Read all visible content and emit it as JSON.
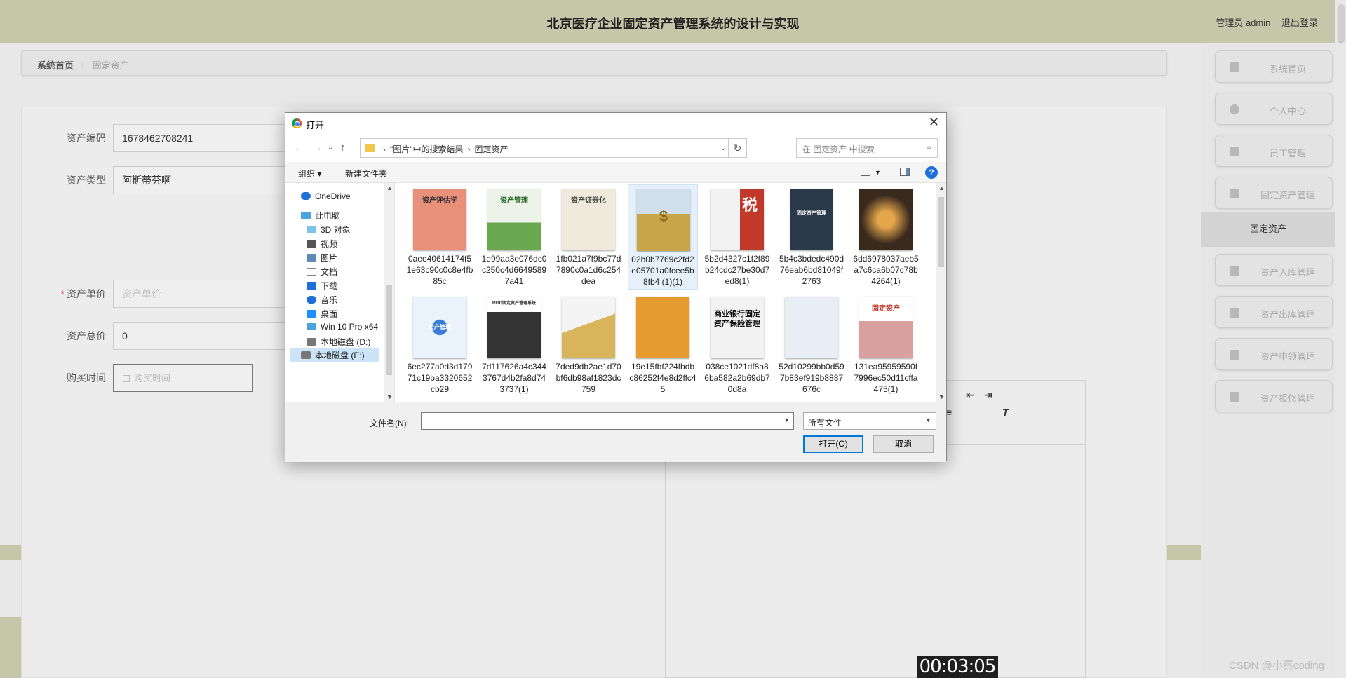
{
  "header": {
    "title": "北京医疗企业固定资产管理系统的设计与实现",
    "user_label": "管理员 admin",
    "logout_label": "退出登录"
  },
  "breadcrumb": {
    "home": "系统首页",
    "current": "固定资产"
  },
  "form": {
    "asset_code_label": "资产编码",
    "asset_code_value": "1678462708241",
    "asset_type_label": "资产类型",
    "asset_type_value": "阿斯蒂芬啊",
    "unit_price_label": "资产单价",
    "unit_price_required": "*",
    "unit_price_placeholder": "资产单价",
    "total_price_label": "资产总价",
    "total_price_value": "0",
    "purchase_time_label": "购买时间",
    "purchase_time_placeholder": "购买时间"
  },
  "sidebar": {
    "items": [
      {
        "label": "系统首页",
        "icon": "home-icon"
      },
      {
        "label": "个人中心",
        "icon": "user-icon"
      },
      {
        "label": "员工管理",
        "icon": "grid-icon"
      },
      {
        "label": "固定资产管理",
        "icon": "clipboard-icon"
      },
      {
        "label": "资产入库管理",
        "icon": "grid-icon"
      },
      {
        "label": "资产出库管理",
        "icon": "briefcase-icon"
      },
      {
        "label": "资产申领管理",
        "icon": "chart-icon"
      },
      {
        "label": "资产报修管理",
        "icon": "chart-icon"
      }
    ],
    "active_sub": "固定资产"
  },
  "dialog": {
    "title": "打开",
    "path": [
      "\"图片\"中的搜索结果",
      "固定资产"
    ],
    "search_placeholder": "在 固定资产 中搜索",
    "organize_label": "组织 ▾",
    "new_folder_label": "新建文件夹",
    "nav_items": [
      {
        "label": "OneDrive",
        "icon": "cloud-icon",
        "color": "#1e6fd9"
      },
      {
        "label": "此电脑",
        "icon": "computer-icon",
        "color": "#4aa3df"
      },
      {
        "label": "3D 对象",
        "icon": "cube-icon",
        "color": "#7cc4ea"
      },
      {
        "label": "视频",
        "icon": "video-icon",
        "color": "#555555"
      },
      {
        "label": "图片",
        "icon": "picture-icon",
        "color": "#5b8cb8"
      },
      {
        "label": "文档",
        "icon": "document-icon",
        "color": "#888888"
      },
      {
        "label": "下载",
        "icon": "download-icon",
        "color": "#1e6fd9"
      },
      {
        "label": "音乐",
        "icon": "music-icon",
        "color": "#1e6fd9"
      },
      {
        "label": "桌面",
        "icon": "desktop-icon",
        "color": "#1e90ff"
      },
      {
        "label": "Win 10 Pro x64",
        "icon": "drive-icon",
        "color": "#4aa3df"
      },
      {
        "label": "本地磁盘 (D:)",
        "icon": "drive-icon",
        "color": "#777777"
      },
      {
        "label": "本地磁盘 (E:)",
        "icon": "drive-icon",
        "color": "#777777"
      }
    ],
    "files": [
      {
        "name": "0aee40614174f51e63c90c0c8e4fb85c",
        "thumb_text": "资产评估学",
        "color": "#e8907a"
      },
      {
        "name": "1e99aa3e076dc0c250c4d66495897a41",
        "thumb_text": "资产管理",
        "color": "#6aa84f"
      },
      {
        "name": "1fb021a7f9bc77d7890c0a1d6c254dea",
        "thumb_text": "资产证券化",
        "color": "#d9d2c0"
      },
      {
        "name": "02b0b7769c2fd2e05701a0fcee5b8fb4 (1)(1)",
        "thumb_text": "$",
        "color": "#c9a54a"
      },
      {
        "name": "5b2d4327c1f2f89b24cdc27be30d7ed8(1)",
        "thumb_text": "税",
        "color": "#c0392b"
      },
      {
        "name": "5b4c3bdedc490d76eab6bd81049f2763",
        "thumb_text": "固定资产管理",
        "color": "#2b3a4a"
      },
      {
        "name": "6dd6978037aeb5a7c6ca6b07c78b4264(1)",
        "thumb_text": "",
        "color": "#5a3d2b"
      },
      {
        "name": "6ec277a0d3d17971c19ba3320652cb29",
        "thumb_text": "资产管理",
        "color": "#3a7bd5"
      },
      {
        "name": "7d117626a4c3443767d4b2fa8d743737(1)",
        "thumb_text": "RFID固定资产管理系统",
        "color": "#333333"
      },
      {
        "name": "7ded9db2ae1d70bf6db98af1823dc759",
        "thumb_text": "",
        "color": "#d8b45a"
      },
      {
        "name": "19e15fbf224fbdbc86252f4e8d2ffc45",
        "thumb_text": "",
        "color": "#e69b2e"
      },
      {
        "name": "038ce1021df8a86ba582a2b69db70d8a",
        "thumb_text": "商业银行固定资产保险管理",
        "color": "#f2f2f2"
      },
      {
        "name": "52d10299bb0d597b83ef919b8887676c",
        "thumb_text": "",
        "color": "#e9edf5"
      },
      {
        "name": "131ea95959590f7996ec50d11cffa475(1)",
        "thumb_text": "固定资产",
        "color": "#f4e1e1"
      }
    ],
    "filename_label": "文件名(N):",
    "filename_value": "",
    "filetype_value": "所有文件",
    "open_label": "打开(O)",
    "cancel_label": "取消"
  },
  "timer": "00:03:05",
  "watermark": "CSDN @小蔡coding"
}
